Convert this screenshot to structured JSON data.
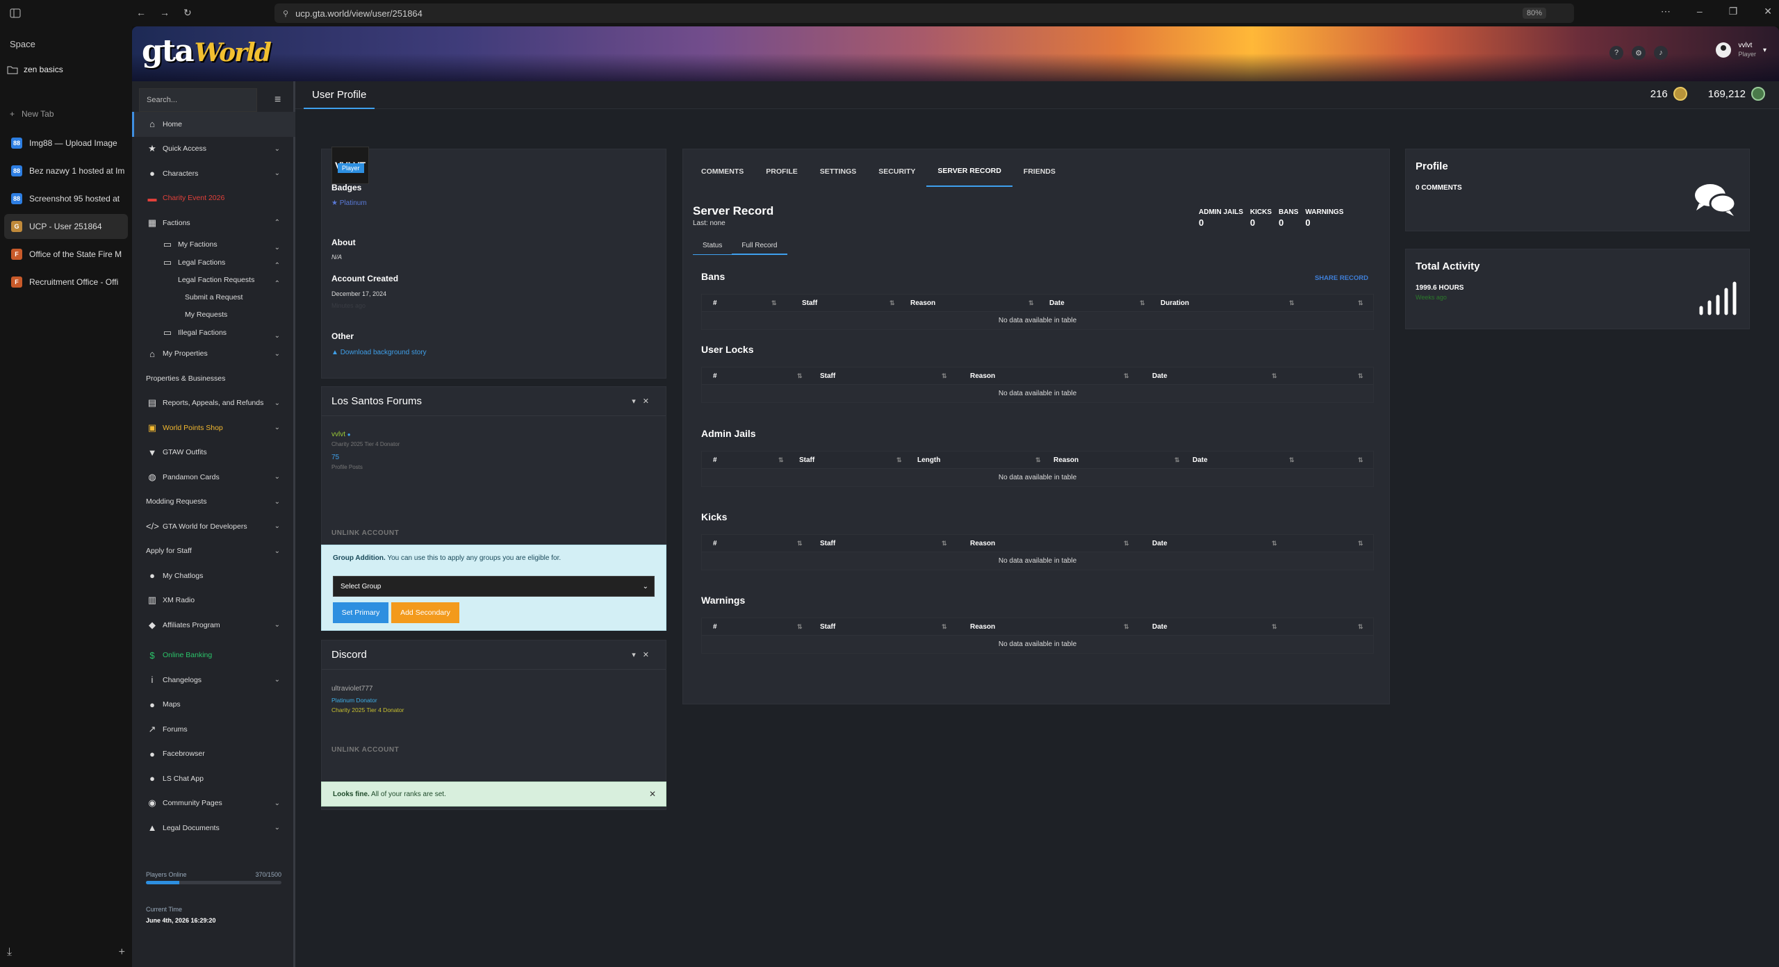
{
  "browser": {
    "space_label": "Space",
    "folder_label": "zen basics",
    "new_tab_label": "New Tab",
    "tabs": [
      {
        "title": "Img88 — Upload Image",
        "color": "#2d7ee2",
        "glyph": "88"
      },
      {
        "title": "Bez nazwy 1 hosted at Im",
        "color": "#2d7ee2",
        "glyph": "88"
      },
      {
        "title": "Screenshot 95 hosted at",
        "color": "#2d7ee2",
        "glyph": "88"
      },
      {
        "title": "UCP - User 251864",
        "color": "#c08a3a",
        "glyph": "G"
      },
      {
        "title": "Office of the State Fire M",
        "color": "#c85a2a",
        "glyph": "F"
      },
      {
        "title": "Recruitment Office - Offi",
        "color": "#c85a2a",
        "glyph": "F"
      }
    ],
    "url": "ucp.gta.world/view/user/251864",
    "zoom": "80%"
  },
  "site": {
    "logo_gta": "gta",
    "logo_world": "World",
    "user_name": "vvlvt",
    "user_role": "Player",
    "header_tab": "User Profile",
    "coins_a": "216",
    "coins_b": "169,212"
  },
  "nav": {
    "search_placeholder": "Search...",
    "items": [
      {
        "label": "Home",
        "icon": "home-icon"
      },
      {
        "label": "Quick Access",
        "icon": "star-icon"
      },
      {
        "label": "Characters",
        "icon": "user-icon"
      },
      {
        "label": "Charity Event 2026",
        "icon": "car-icon"
      },
      {
        "label": "Factions",
        "icon": "building-icon"
      },
      {
        "label": "My Factions"
      },
      {
        "label": "Legal Factions"
      },
      {
        "label": "Legal Faction Requests"
      },
      {
        "label": "Submit a Request"
      },
      {
        "label": "My Requests"
      },
      {
        "label": "Illegal Factions"
      },
      {
        "label": "My Properties",
        "icon": "house-icon"
      },
      {
        "label": "Properties & Businesses"
      },
      {
        "label": "Reports, Appeals, and Refunds",
        "icon": "file-icon"
      },
      {
        "label": "World Points Shop",
        "icon": "cart-icon"
      },
      {
        "label": "GTAW Outfits",
        "icon": "shirt-icon"
      },
      {
        "label": "Pandamon Cards",
        "icon": "globe-icon"
      },
      {
        "label": "Modding Requests"
      },
      {
        "label": "GTA World for Developers",
        "icon": "code-icon"
      },
      {
        "label": "Apply for Staff"
      },
      {
        "label": "My Chatlogs",
        "icon": "chat-icon"
      },
      {
        "label": "XM Radio",
        "icon": "radio-icon"
      },
      {
        "label": "Affiliates Program",
        "icon": "handshake-icon"
      },
      {
        "label": "Online Banking",
        "icon": "dollar-icon"
      },
      {
        "label": "Changelogs",
        "icon": "info-icon"
      },
      {
        "label": "Maps",
        "icon": "pin-icon"
      },
      {
        "label": "Forums",
        "icon": "external-icon"
      },
      {
        "label": "Facebrowser",
        "icon": "people-icon"
      },
      {
        "label": "LS Chat App",
        "icon": "chat-icon"
      },
      {
        "label": "Community Pages",
        "icon": "discord-icon"
      },
      {
        "label": "Legal Documents",
        "icon": "lock-icon"
      }
    ],
    "players_label": "Players Online",
    "players_value": "370/1500",
    "players_fraction": 0.2467,
    "time_label": "Current Time",
    "time_value": "June 4th, 2026 16:29:20"
  },
  "profile": {
    "avatar_text": "VVLVT",
    "role_badge": "Player",
    "badges_label": "Badges",
    "badge_platinum": "Platinum",
    "about_label": "About",
    "about_value": "N/A",
    "created_label": "Account Created",
    "created_value": "December 17, 2024",
    "created_sub": "Minutes ago",
    "other_label": "Other",
    "download_link": "Download background story"
  },
  "forums": {
    "title": "Los Santos Forums",
    "username": "vvlvt",
    "rank": "Charity 2025 Tier 4 Donator",
    "posts": "75",
    "posts_label": "Profile Posts",
    "unlink": "UNLINK ACCOUNT"
  },
  "group": {
    "lead": "Group Addition.",
    "text": "You can use this to apply any groups you are eligible for.",
    "select": "Select Group",
    "primary": "Set Primary",
    "secondary": "Add Secondary"
  },
  "discord": {
    "title": "Discord",
    "username": "ultraviolet777",
    "role1": "Platinum Donator",
    "role2": "Charity 2025 Tier 4 Donator",
    "unlink": "UNLINK ACCOUNT"
  },
  "ranks_alert": {
    "lead": "Looks fine.",
    "text": "All of your ranks are set."
  },
  "tabs": [
    "COMMENTS",
    "PROFILE",
    "SETTINGS",
    "SECURITY",
    "SERVER RECORD",
    "FRIENDS"
  ],
  "server_record": {
    "title": "Server Record",
    "last": "Last: none",
    "stats": [
      {
        "label": "ADMIN JAILS",
        "value": "0"
      },
      {
        "label": "KICKS",
        "value": "0"
      },
      {
        "label": "BANS",
        "value": "0"
      },
      {
        "label": "WARNINGS",
        "value": "0"
      }
    ],
    "subtabs": [
      "Status",
      "Full Record"
    ],
    "share": "SHARE RECORD",
    "empty": "No data available in table",
    "sections": [
      {
        "title": "Bans",
        "cols": [
          "#",
          "Staff",
          "Reason",
          "Date",
          "Duration"
        ]
      },
      {
        "title": "User Locks",
        "cols": [
          "#",
          "Staff",
          "Reason",
          "Date"
        ]
      },
      {
        "title": "Admin Jails",
        "cols": [
          "#",
          "Staff",
          "Length",
          "Reason",
          "Date"
        ]
      },
      {
        "title": "Kicks",
        "cols": [
          "#",
          "Staff",
          "Reason",
          "Date"
        ]
      },
      {
        "title": "Warnings",
        "cols": [
          "#",
          "Staff",
          "Reason",
          "Date"
        ]
      }
    ]
  },
  "side": {
    "profile_title": "Profile",
    "comments": "0 COMMENTS",
    "activity_title": "Total Activity",
    "hours": "1999.6 HOURS",
    "hours_sub": "Weeks ago"
  },
  "colors": {
    "accent": "#3fa0ee",
    "group_alert_bg": "#d3eff5",
    "ok_alert_bg": "#d8efdd",
    "secondary_btn": "#f39a1c"
  }
}
